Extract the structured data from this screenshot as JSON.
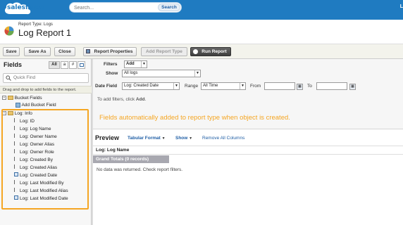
{
  "topbar": {
    "brand": "salesforce",
    "search_placeholder": "Search...",
    "search_button": "Search",
    "user_initial": "L"
  },
  "header": {
    "report_type": "Report Type: Logs",
    "title": "Log Report 1"
  },
  "toolbar": {
    "save": "Save",
    "save_as": "Save As",
    "close": "Close",
    "report_properties": "Report Properties",
    "add_report_type": "Add Report Type",
    "run_report": "Run Report"
  },
  "fields_panel": {
    "title": "Fields",
    "filter_all": "All",
    "filter_text": "a",
    "filter_number": "#",
    "quick_find_placeholder": "Quick Find",
    "drag_hint": "Drag and drop to add fields to the report.",
    "bucket_folder": "Bucket Fields",
    "add_bucket": "Add Bucket Field",
    "log_folder": "Log: Info",
    "log_fields": [
      "Log: ID",
      "Log: Log Name",
      "Log: Owner Name",
      "Log: Owner Alias",
      "Log: Owner Role",
      "Log: Created By",
      "Log: Created Alias",
      "Log: Created Date",
      "Log: Last Modified By",
      "Log: Last Modified Alias",
      "Log: Last Modified Date"
    ]
  },
  "filters": {
    "filters_label": "Filters",
    "add_label": "Add",
    "show_label": "Show",
    "show_value": "All logs",
    "date_field_label": "Date Field",
    "date_field_value": "Log: Created Date",
    "range_label": "Range",
    "range_value": "All Time",
    "from_label": "From",
    "to_label": "To",
    "add_hint_prefix": "To add filters, click ",
    "add_hint_bold": "Add",
    "add_hint_suffix": "."
  },
  "notice": "Fields automatically added to report type when object is created.",
  "preview": {
    "title": "Preview",
    "format": "Tabular Format",
    "show": "Show",
    "remove_all": "Remove All Columns",
    "column_header": "Log: Log Name",
    "grand_totals": "Grand Totals (0 records)",
    "no_data": "No data was returned. Check report filters."
  }
}
